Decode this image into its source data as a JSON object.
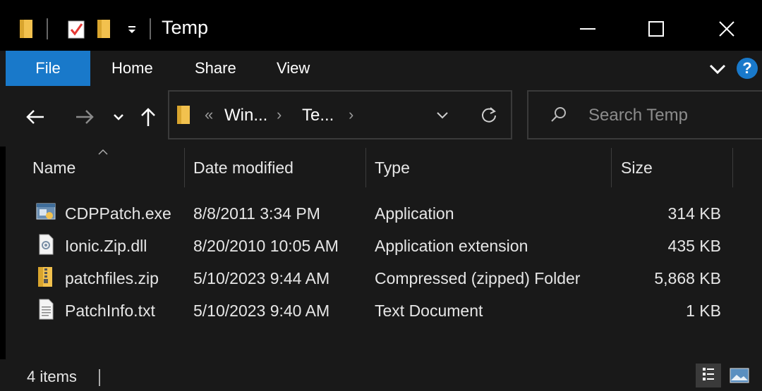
{
  "window": {
    "title": "Temp",
    "minimize_icon": "minimize-icon",
    "maximize_icon": "maximize-icon",
    "close_icon": "close-icon"
  },
  "ribbon": {
    "tabs": [
      {
        "label": "File",
        "active": true
      },
      {
        "label": "Home"
      },
      {
        "label": "Share"
      },
      {
        "label": "View"
      }
    ],
    "help_label": "?"
  },
  "address": {
    "overflow": "«",
    "crumbs": [
      "Win...",
      "Te..."
    ]
  },
  "search": {
    "placeholder": "Search Temp"
  },
  "columns": [
    "Name",
    "Date modified",
    "Type",
    "Size"
  ],
  "files": [
    {
      "name": "CDPPatch.exe",
      "date": "8/8/2011 3:34 PM",
      "type": "Application",
      "size": "314 KB",
      "icon": "application-icon"
    },
    {
      "name": "Ionic.Zip.dll",
      "date": "8/20/2010 10:05 AM",
      "type": "Application extension",
      "size": "435 KB",
      "icon": "dll-file-icon"
    },
    {
      "name": "patchfiles.zip",
      "date": "5/10/2023 9:44 AM",
      "type": "Compressed (zipped) Folder",
      "size": "5,868 KB",
      "icon": "zip-folder-icon"
    },
    {
      "name": "PatchInfo.txt",
      "date": "5/10/2023 9:40 AM",
      "type": "Text Document",
      "size": "1 KB",
      "icon": "text-file-icon"
    }
  ],
  "status": {
    "item_count": "4 items"
  },
  "colors": {
    "accent": "#1979ca",
    "folder": "#f2c14e",
    "background": "#191919"
  }
}
